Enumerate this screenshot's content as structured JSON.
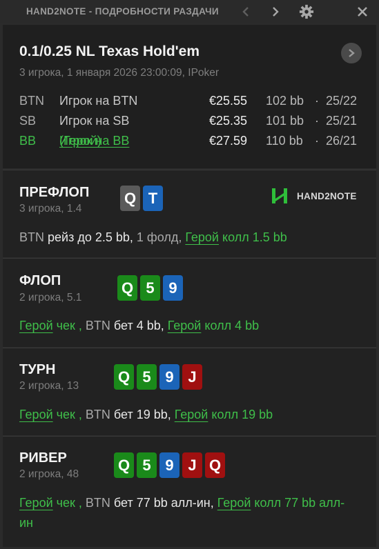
{
  "titlebar": {
    "title": "HAND2NOTE - ПОДРОБНОСТИ РАЗДАЧИ"
  },
  "header": {
    "title": "0.1/0.25 NL Texas Hold'em",
    "subtitle": "3 игрока, 1 января 2026 23:00:09, IPoker",
    "players": [
      {
        "pos": "BTN",
        "name": "Игрок на BTN",
        "hero_tag": "",
        "stack": "€25.55",
        "bb": "102 bb",
        "sep": "·",
        "ratio": "25/22"
      },
      {
        "pos": "SB",
        "name": "Игрок на SB",
        "hero_tag": "",
        "stack": "€25.35",
        "bb": "101 bb",
        "sep": "·",
        "ratio": "25/21"
      },
      {
        "pos": "BB",
        "name": "Игрок на BB",
        "hero_tag": " (Герой)",
        "stack": "€27.59",
        "bb": "110 bb",
        "sep": "·",
        "ratio": "26/21"
      }
    ]
  },
  "logo": {
    "text": "HAND2NOTE"
  },
  "streets": {
    "preflop": {
      "name": "ПРЕФЛОП",
      "info": "3 игрока, 1.4",
      "cards": [
        {
          "rank": "Q",
          "color": "grey"
        },
        {
          "rank": "T",
          "color": "blue"
        }
      ],
      "action": {
        "p1": "BTN",
        "t1": " рейз до 2.5 bb, ",
        "t2": "1 фолд, ",
        "hero": "Герой",
        "t3": " колл 1.5 bb"
      }
    },
    "flop": {
      "name": "ФЛОП",
      "info": "2 игрока, 5.1",
      "cards": [
        {
          "rank": "Q",
          "color": "green"
        },
        {
          "rank": "5",
          "color": "green"
        },
        {
          "rank": "9",
          "color": "blue"
        }
      ],
      "action": {
        "hero1": "Герой",
        "t1": " чек , ",
        "p1": "BTN",
        "t2": " бет 4 bb, ",
        "hero2": "Герой",
        "t3": " колл 4 bb"
      }
    },
    "turn": {
      "name": "ТУРН",
      "info": "2 игрока, 13",
      "cards": [
        {
          "rank": "Q",
          "color": "green"
        },
        {
          "rank": "5",
          "color": "green"
        },
        {
          "rank": "9",
          "color": "blue"
        },
        {
          "rank": "J",
          "color": "red"
        }
      ],
      "action": {
        "hero1": "Герой",
        "t1": " чек , ",
        "p1": "BTN",
        "t2": " бет 19 bb, ",
        "hero2": "Герой",
        "t3": " колл 19 bb"
      }
    },
    "river": {
      "name": "РИВЕР",
      "info": "2 игрока, 48",
      "cards": [
        {
          "rank": "Q",
          "color": "green"
        },
        {
          "rank": "5",
          "color": "green"
        },
        {
          "rank": "9",
          "color": "blue"
        },
        {
          "rank": "J",
          "color": "red"
        },
        {
          "rank": "Q",
          "color": "red"
        }
      ],
      "action": {
        "hero1": "Герой",
        "t1": " чек , ",
        "p1": "BTN",
        "t2": " бет 77 bb алл-ин, ",
        "hero2": "Герой",
        "t3": " колл 77 bb алл-ин"
      }
    }
  },
  "colors": {
    "hero": "#3fbf4a",
    "card_green": "#1a8a1a",
    "card_blue": "#1b64b8",
    "card_red": "#a01010",
    "card_grey": "#5a5a5a"
  },
  "icons": {
    "back": "chevron-left-icon",
    "forward": "chevron-right-icon",
    "settings": "gear-icon",
    "close": "close-icon",
    "open": "chevron-right-circle-icon"
  }
}
